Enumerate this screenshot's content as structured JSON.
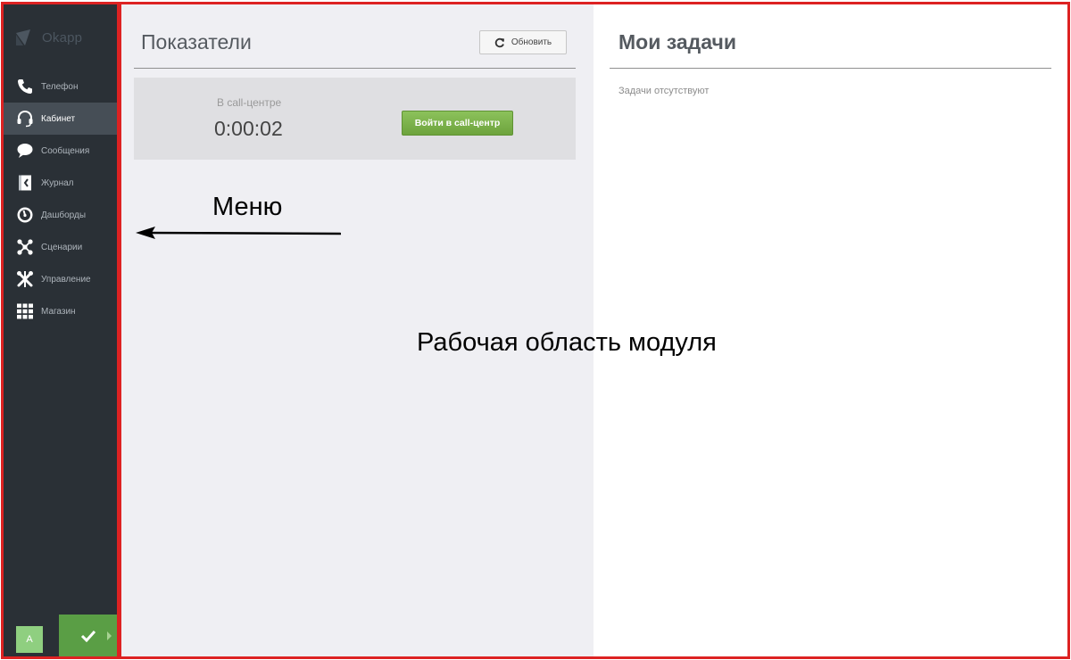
{
  "sidebar": {
    "logo_text": "Okapp",
    "items": [
      {
        "label": "Телефон",
        "icon": "phone-icon",
        "active": false
      },
      {
        "label": "Кабинет",
        "icon": "headset-icon",
        "active": true
      },
      {
        "label": "Сообщения",
        "icon": "chat-bubble-icon",
        "active": false
      },
      {
        "label": "Журнал",
        "icon": "journal-icon",
        "active": false
      },
      {
        "label": "Дашборды",
        "icon": "gauge-icon",
        "active": false
      },
      {
        "label": "Сценарии",
        "icon": "network-icon",
        "active": false
      },
      {
        "label": "Управление",
        "icon": "tools-icon",
        "active": false
      },
      {
        "label": "Магазин",
        "icon": "grid-icon",
        "active": false
      }
    ],
    "user_initial": "A",
    "status_icon": "checkmark-icon"
  },
  "indicators": {
    "title": "Показатели",
    "refresh_label": "Обновить",
    "callcenter_label": "В call-центре",
    "callcenter_time": "0:00:02",
    "enter_button_label": "Войти в call-центр"
  },
  "tasks": {
    "title": "Мои задачи",
    "empty_text": "Задачи отсутствуют"
  },
  "annotations": {
    "menu": "Меню",
    "workspace": "Рабочая область модуля"
  },
  "colors": {
    "sidebar_bg": "#2a3036",
    "active_item_bg": "#464e56",
    "accent_green": "#6da33d",
    "annotation_red": "#dd2222"
  }
}
